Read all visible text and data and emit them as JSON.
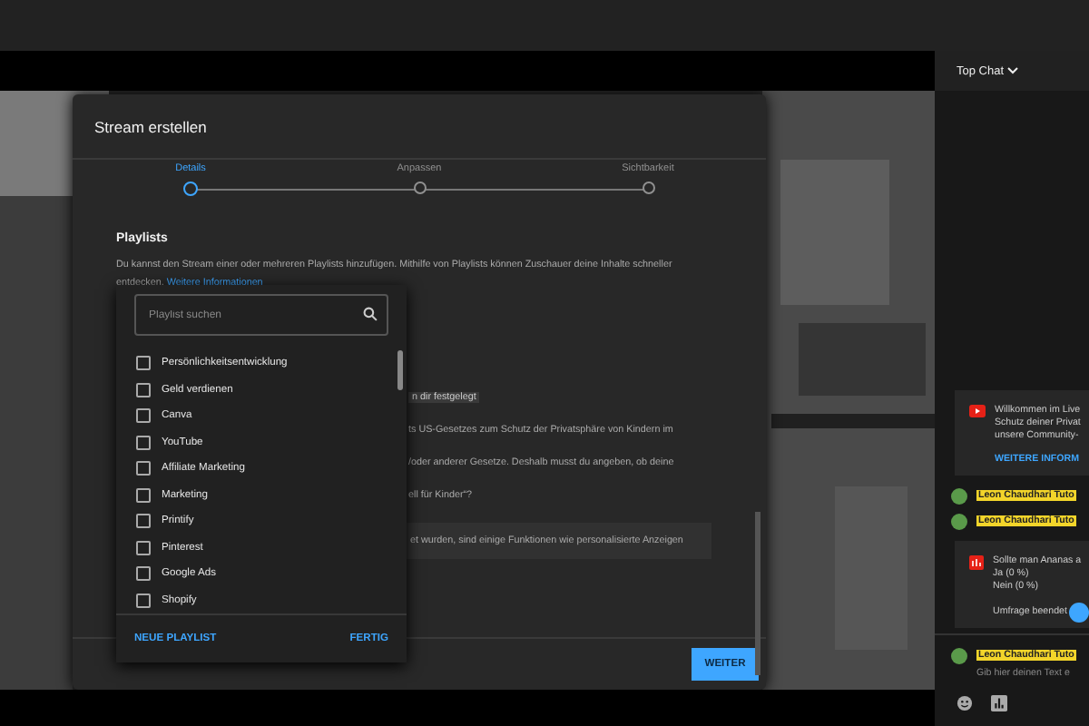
{
  "chat": {
    "header": "Top Chat",
    "welcome": {
      "lines": [
        "Willkommen im Live",
        "Schutz deiner Privat",
        "unsere Community-"
      ],
      "link": "WEITERE INFORM"
    },
    "messages": [
      {
        "author": "Leon Chaudhari Tuto"
      },
      {
        "author": "Leon Chaudhari Tuto"
      }
    ],
    "poll": {
      "question": "Sollte man Ananas a",
      "options": [
        "Ja (0 %)",
        "Nein (0 %)"
      ],
      "status": "Umfrage beendet"
    },
    "composer": {
      "author": "Leon Chaudhari Tuto",
      "placeholder": "Gib hier deinen Text e"
    }
  },
  "dialog": {
    "title": "Stream erstellen",
    "steps": [
      {
        "label": "Details",
        "selected": true
      },
      {
        "label": "Anpassen",
        "selected": false
      },
      {
        "label": "Sichtbarkeit",
        "selected": false
      }
    ],
    "section_title": "Playlists",
    "description": "Du kannst den Stream einer oder mehreren Playlists hinzufügen. Mithilfe von Playlists können Zuschauer deine Inhalte schneller entdecken.",
    "description_link": "Weitere Informationen",
    "covered_chip": "n dir festgelegt",
    "covered_lines": [
      "ts US-Gesetzes zum Schutz der Privatsphäre von Kindern im",
      "/oder anderer Gesetze. Deshalb musst du angeben, ob deine"
    ],
    "covered_link": "ell für Kinder“?",
    "covered_notice": "et wurden, sind einige Funktionen wie personalisierte Anzeigen",
    "next_button": "WEITER"
  },
  "playlist_picker": {
    "search": {
      "placeholder": "Playlist suchen"
    },
    "items": [
      {
        "label": "Persönlichkeitsentwicklung",
        "checked": false
      },
      {
        "label": "Geld verdienen",
        "checked": false
      },
      {
        "label": "Canva",
        "checked": false
      },
      {
        "label": "YouTube",
        "checked": false
      },
      {
        "label": "Affiliate Marketing",
        "checked": false
      },
      {
        "label": "Marketing",
        "checked": false
      },
      {
        "label": "Printify",
        "checked": false
      },
      {
        "label": "Pinterest",
        "checked": false
      },
      {
        "label": "Google Ads",
        "checked": false
      },
      {
        "label": "Shopify",
        "checked": false
      }
    ],
    "new_button": "NEUE PLAYLIST",
    "done_button": "FERTIG"
  }
}
